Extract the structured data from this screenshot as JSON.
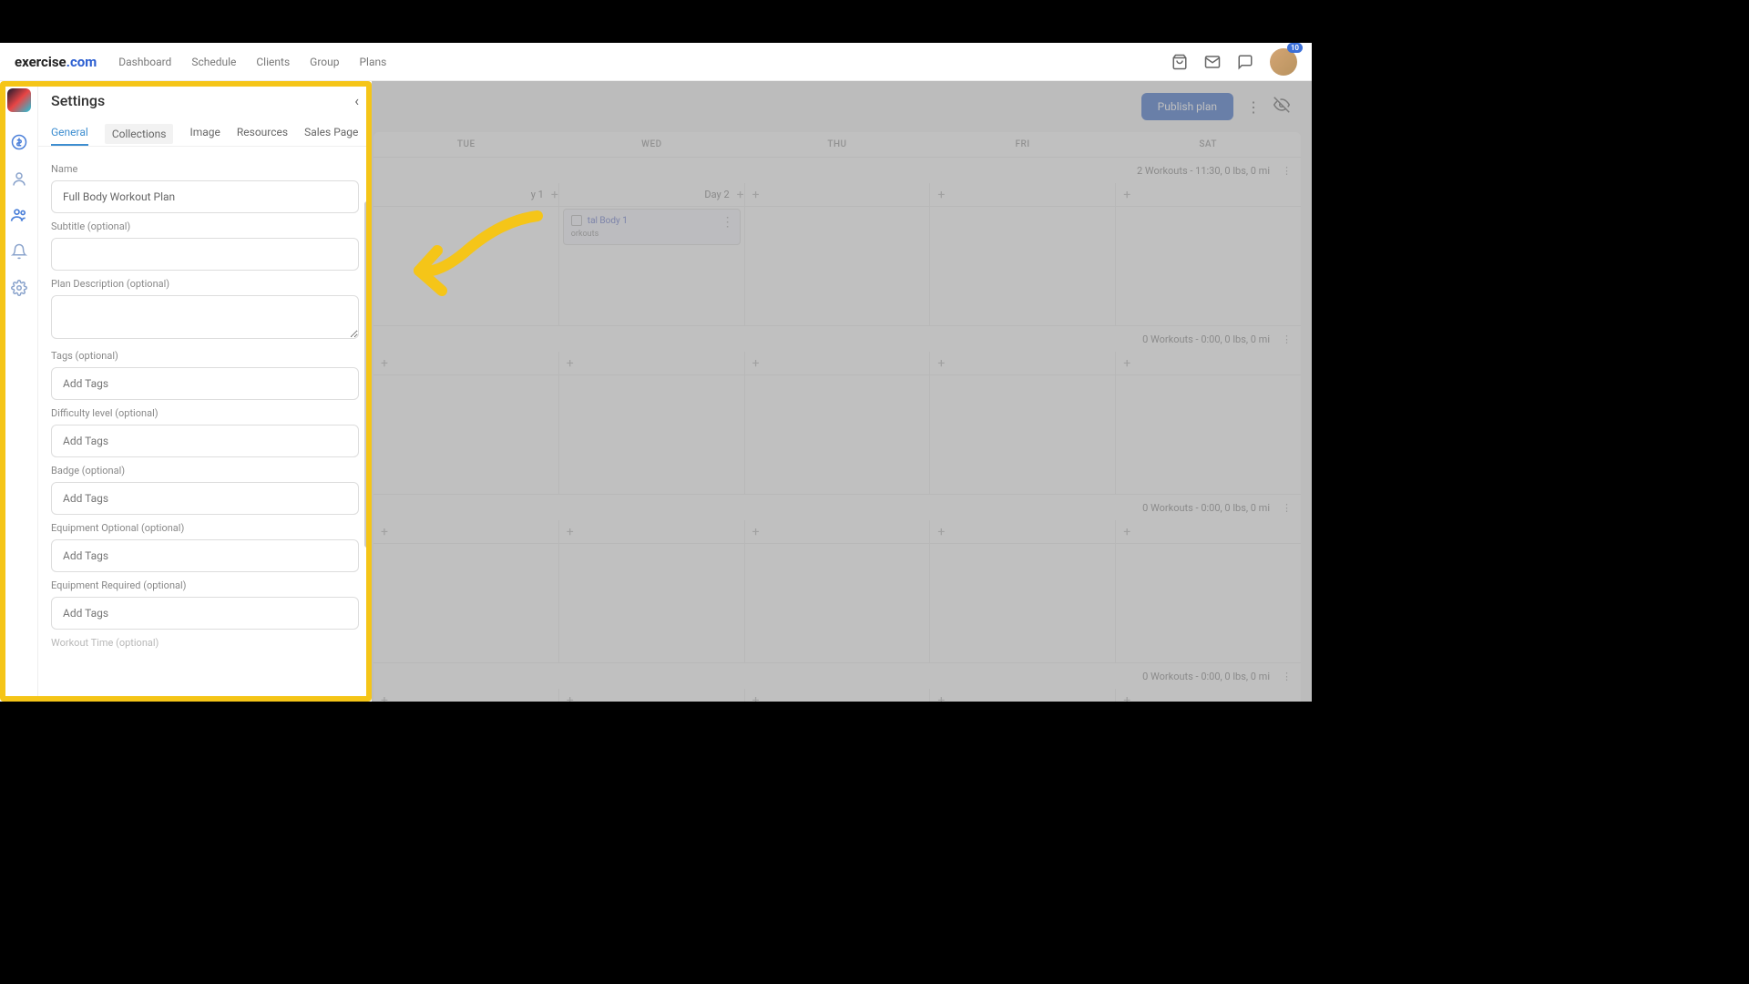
{
  "logo": {
    "part1": "exercise",
    "part2": ".com"
  },
  "nav": {
    "dashboard": "Dashboard",
    "schedule": "Schedule",
    "clients": "Clients",
    "group": "Group",
    "plans": "Plans"
  },
  "notification_count": "10",
  "actionbar": {
    "publish": "Publish plan"
  },
  "calendar": {
    "days": [
      "TUE",
      "WED",
      "THU",
      "FRI",
      "SAT"
    ],
    "week1": {
      "summary": "2 Workouts - 11:30, 0 lbs, 0 mi",
      "day1_label": "y 1",
      "day2_label": "Day 2"
    },
    "week2": {
      "summary": "0 Workouts - 0:00, 0 lbs, 0 mi"
    },
    "week3": {
      "summary": "0 Workouts - 0:00, 0 lbs, 0 mi"
    },
    "week4": {
      "summary": "0 Workouts - 0:00, 0 lbs, 0 mi"
    },
    "workout_card": {
      "title": "tal Body 1",
      "sub": "orkouts"
    }
  },
  "settings": {
    "title": "Settings",
    "tabs": {
      "general": "General",
      "collections": "Collections",
      "image": "Image",
      "resources": "Resources",
      "sales": "Sales Page"
    },
    "fields": {
      "name_label": "Name",
      "name_value": "Full Body Workout Plan",
      "subtitle_label": "Subtitle (optional)",
      "subtitle_value": "",
      "desc_label": "Plan Description (optional)",
      "desc_value": "",
      "tags_label": "Tags (optional)",
      "tags_placeholder": "Add Tags",
      "difficulty_label": "Difficulty level (optional)",
      "difficulty_placeholder": "Add Tags",
      "badge_label": "Badge (optional)",
      "badge_placeholder": "Add Tags",
      "equip_opt_label": "Equipment Optional (optional)",
      "equip_opt_placeholder": "Add Tags",
      "equip_req_label": "Equipment Required (optional)",
      "equip_req_placeholder": "Add Tags",
      "workout_time_label": "Workout Time (optional)"
    }
  }
}
